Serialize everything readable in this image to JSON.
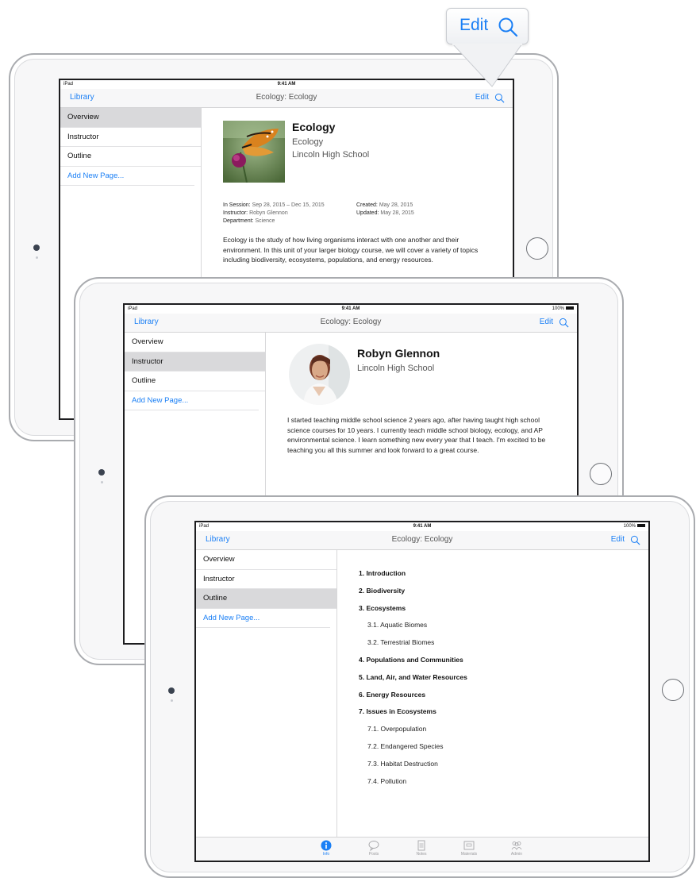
{
  "callout": {
    "edit_label": "Edit",
    "icon": "search-icon"
  },
  "status_bar": {
    "carrier": "iPad",
    "time": "9:41 AM",
    "battery": "100%"
  },
  "nav": {
    "library": "Library",
    "title": "Ecology: Ecology",
    "edit": "Edit",
    "search_icon": "search-icon"
  },
  "sidebar": {
    "items": [
      "Overview",
      "Instructor",
      "Outline"
    ],
    "add_label": "Add New Page..."
  },
  "overview": {
    "course_title": "Ecology",
    "course_subject": "Ecology",
    "school": "Lincoln High School",
    "in_session_label": "In Session:",
    "in_session_value": "Sep 28, 2015 – Dec 15, 2015",
    "instructor_label": "Instructor:",
    "instructor_value": "Robyn Glennon",
    "department_label": "Department:",
    "department_value": "Science",
    "created_label": "Created:",
    "created_value": "May 28, 2015",
    "updated_label": "Updated:",
    "updated_value": "May 28, 2015",
    "description": "Ecology is the study of how living organisms interact with one another and their environment. In this unit of your larger biology course, we will cover a variety of topics including biodiversity, ecosystems, populations, and energy resources."
  },
  "instructor": {
    "name": "Robyn Glennon",
    "school": "Lincoln High School",
    "bio": "I started teaching middle school science 2 years ago, after having taught high school science courses for 10 years. I currently teach middle school biology, ecology, and AP environmental science. I learn something new every year that I teach. I'm excited to be teaching you all this summer and look forward to a great course."
  },
  "outline": {
    "items": [
      {
        "text": "1.  Introduction",
        "level": 1
      },
      {
        "text": "2.  Biodiversity",
        "level": 1
      },
      {
        "text": "3.  Ecosystems",
        "level": 1
      },
      {
        "text": "3.1.  Aquatic Biomes",
        "level": 2
      },
      {
        "text": "3.2.  Terrestrial Biomes",
        "level": 2
      },
      {
        "text": "4.  Populations and Communities",
        "level": 1
      },
      {
        "text": "5.  Land, Air, and Water Resources",
        "level": 1
      },
      {
        "text": "6.  Energy Resources",
        "level": 1
      },
      {
        "text": "7.  Issues in Ecosystems",
        "level": 1
      },
      {
        "text": "7.1.  Overpopulation",
        "level": 2
      },
      {
        "text": "7.2.  Endangered Species",
        "level": 2
      },
      {
        "text": "7.3.  Habitat Destruction",
        "level": 2
      },
      {
        "text": "7.4.  Pollution",
        "level": 2
      }
    ]
  },
  "tabbar": {
    "tabs": [
      {
        "label": "Info",
        "icon": "info-icon"
      },
      {
        "label": "Posts",
        "icon": "speech-bubble-icon"
      },
      {
        "label": "Notes",
        "icon": "notes-icon"
      },
      {
        "label": "Materials",
        "icon": "materials-icon"
      },
      {
        "label": "Admin",
        "icon": "people-icon"
      }
    ]
  },
  "colors": {
    "accent": "#1a7ff5",
    "selected_row": "#d9d9db"
  }
}
